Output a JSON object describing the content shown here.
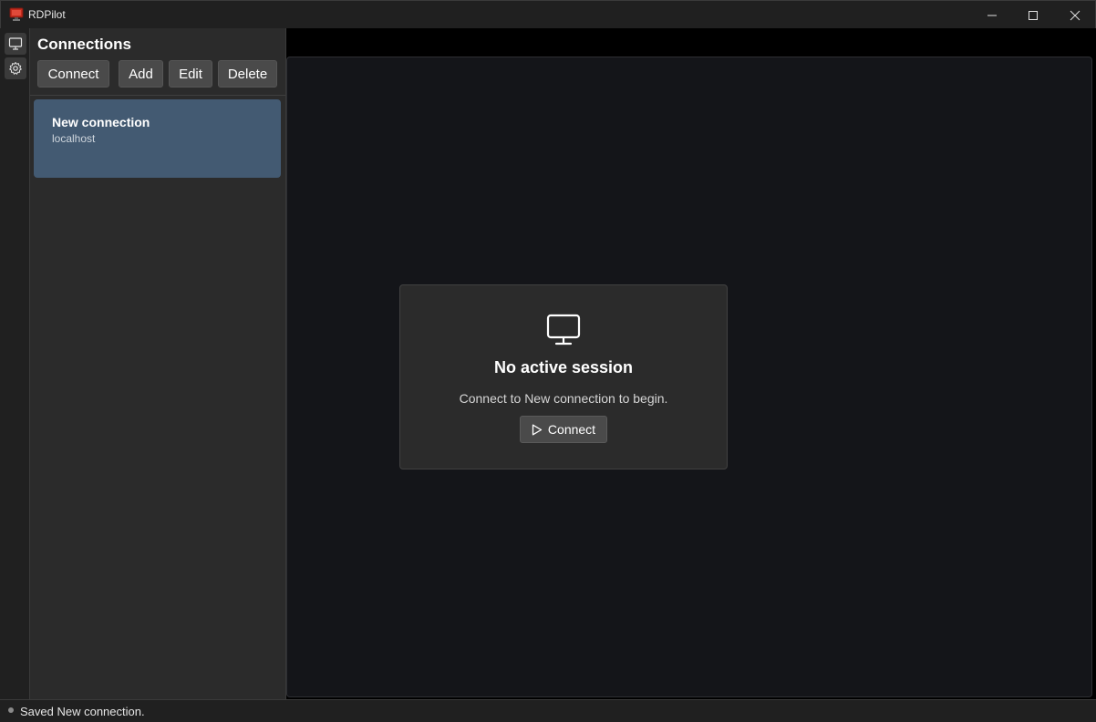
{
  "window": {
    "title": "RDPilot"
  },
  "rail": {
    "items": [
      {
        "icon": "monitor-icon"
      },
      {
        "icon": "gear-icon"
      }
    ]
  },
  "sidebar": {
    "title": "Connections",
    "toolbar": {
      "connect_label": "Connect",
      "add_label": "Add",
      "edit_label": "Edit",
      "delete_label": "Delete"
    },
    "connections": [
      {
        "name": "New connection",
        "host": "localhost",
        "selected": true
      }
    ]
  },
  "session": {
    "empty_title": "No active session",
    "empty_message": "Connect to New connection to begin.",
    "connect_label": "Connect"
  },
  "status": {
    "text": "Saved New connection."
  },
  "colors": {
    "selected_item": "#435a72",
    "logo_red": "#c42b1c"
  }
}
